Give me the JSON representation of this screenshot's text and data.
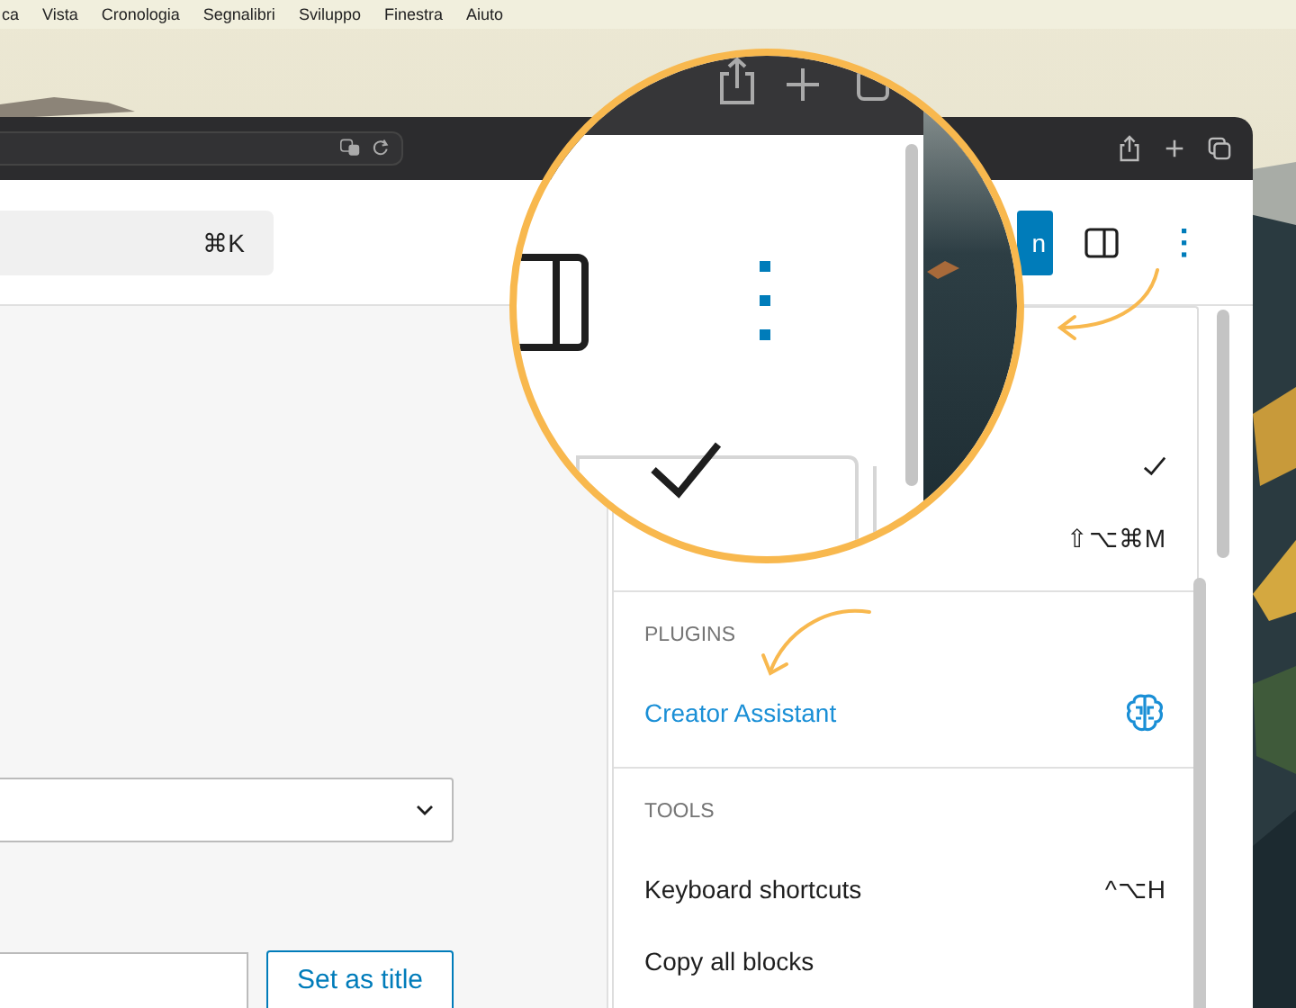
{
  "menu_bar": {
    "items": [
      "ca",
      "Vista",
      "Cronologia",
      "Segnalibri",
      "Sviluppo",
      "Finestra",
      "Aiuto"
    ]
  },
  "editor": {
    "search_shortcut": "⌘K",
    "primary_button": "n",
    "title_button": "Set as title"
  },
  "options_menu": {
    "sections": [
      {
        "items": [
          {
            "kind": "toggle",
            "checked": true
          },
          {
            "kind": "action",
            "shortcut": "⇧⌥⌘M"
          }
        ]
      },
      {
        "heading": "PLUGINS",
        "items": [
          {
            "kind": "plugin",
            "label": "Creator Assistant"
          }
        ]
      },
      {
        "heading": "TOOLS",
        "items": [
          {
            "kind": "action",
            "label": "Keyboard shortcuts",
            "shortcut": "^⌥H"
          },
          {
            "kind": "action",
            "label": "Copy all blocks"
          }
        ]
      }
    ]
  }
}
